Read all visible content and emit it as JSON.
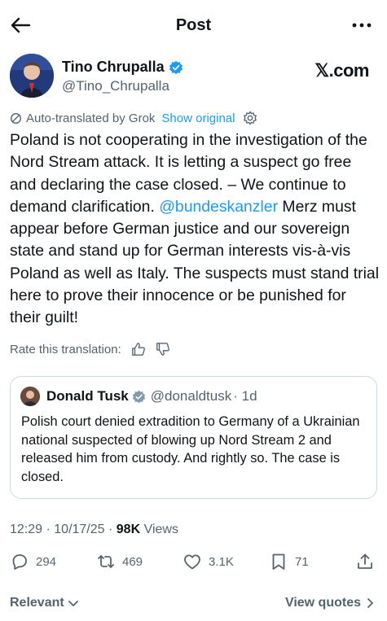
{
  "header": {
    "title": "Post",
    "back_icon": "back-arrow-icon",
    "more_icon": "more-dots-icon"
  },
  "author": {
    "name": "Tino Chrupalla",
    "handle": "@Tino_Chrupalla",
    "brand": "𝕏.com"
  },
  "translation": {
    "label": "Auto-translated by Grok",
    "show_original": "Show original"
  },
  "post": {
    "text_part1": "Poland is not cooperating in the investigation of the Nord Stream attack. It is letting a suspect go free and declaring the case closed. – We continue to demand clarification. ",
    "mention": "@bundeskanzler",
    "text_part2": " Merz must appear before German justice and our sovereign state and stand up for German interests vis-à-vis Poland as well as Italy. The suspects must stand trial here to prove their innocence or be punished for their guilt!"
  },
  "rate": {
    "label": "Rate this translation:"
  },
  "quote": {
    "name": "Donald Tusk",
    "handle": "@donaldtusk",
    "age": "· 1d",
    "text": "Polish court denied extradition to Germany of a Ukrainian national suspected of blowing up Nord Stream 2 and released him from custody. And rightly so. The case is closed."
  },
  "meta": {
    "time": "12:29",
    "date": "10/17/25",
    "views_count": "98K",
    "views_label": "Views"
  },
  "actions": {
    "replies": "294",
    "reposts": "469",
    "likes": "3.1K",
    "bookmarks": "71"
  },
  "footer": {
    "relevant": "Relevant",
    "view_quotes": "View quotes"
  },
  "colors": {
    "accent": "#1d9bf0",
    "text": "#0f1419",
    "muted": "#536471",
    "border": "#cfd9de"
  }
}
